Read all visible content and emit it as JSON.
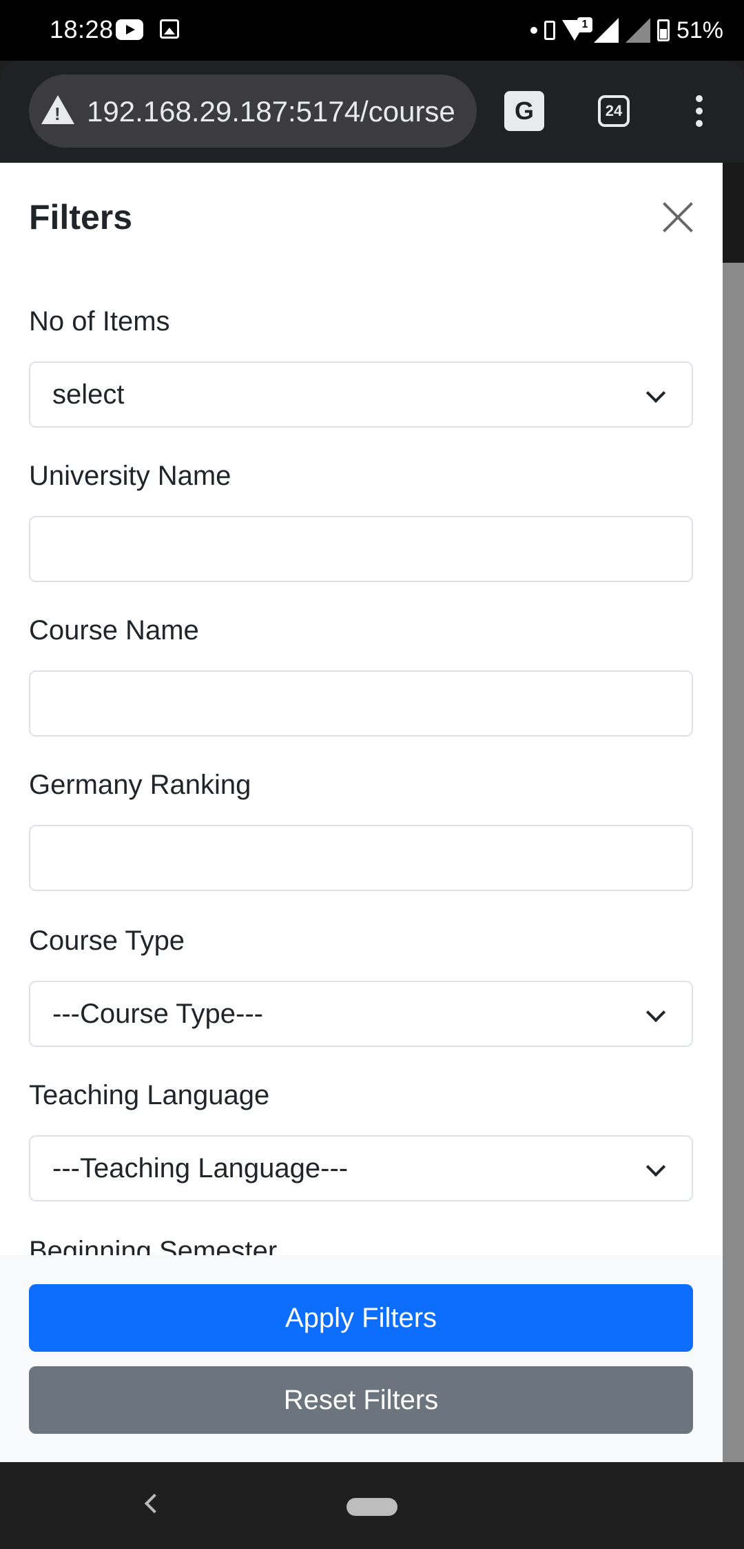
{
  "status": {
    "time": "18:28",
    "battery": "51%",
    "wifi_badge": "1"
  },
  "browser": {
    "url": "192.168.29.187:5174/course",
    "tab_count": "24",
    "translate_glyph": "G"
  },
  "filters": {
    "title": "Filters",
    "no_of_items": {
      "label": "No of Items",
      "value": "select"
    },
    "university_name": {
      "label": "University Name",
      "value": ""
    },
    "course_name": {
      "label": "Course Name",
      "value": ""
    },
    "germany_ranking": {
      "label": "Germany Ranking",
      "value": ""
    },
    "course_type": {
      "label": "Course Type",
      "value": "---Course Type---"
    },
    "teaching_language": {
      "label": "Teaching Language",
      "value": "---Teaching Language---"
    },
    "beginning_semester": {
      "label": "Beginning Semester"
    },
    "apply_label": "Apply Filters",
    "reset_label": "Reset Filters"
  }
}
